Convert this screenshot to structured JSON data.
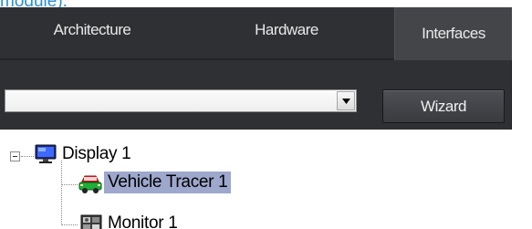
{
  "top_link_fragment": "module).",
  "tabs": [
    {
      "label": "Architecture"
    },
    {
      "label": "Hardware"
    },
    {
      "label": "Interfaces",
      "active": true
    }
  ],
  "combo": {
    "value": ""
  },
  "wizard_label": "Wizard",
  "tree": {
    "root": {
      "label": "Display 1",
      "icon": "display-icon",
      "expanded": true
    },
    "children": [
      {
        "label": "Vehicle Tracer 1",
        "icon": "vehicle-icon",
        "selected": true
      },
      {
        "label": "Monitor 1",
        "icon": "monitor-icon"
      }
    ]
  },
  "colors": {
    "panel": "#2f3033",
    "active_tab": "#434549",
    "selection": "#9ea7cc",
    "link": "#2a8fd0"
  }
}
